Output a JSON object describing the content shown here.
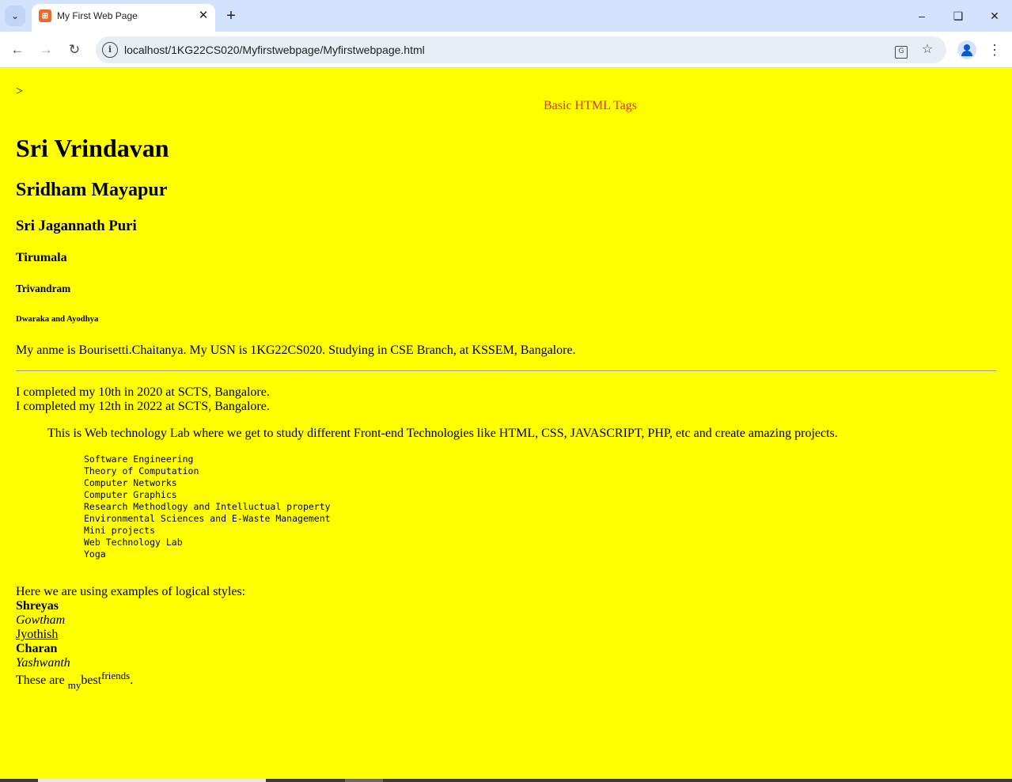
{
  "browser": {
    "tab_title": "My First Web Page",
    "url": "localhost/1KG22CS020/Myfirstwebpage/Myfirstwebpage.html"
  },
  "page": {
    "background_color": "#ffff00",
    "stray_text": ">",
    "marquee_text": "Basic HTML Tags",
    "marquee_color": "#e0301e",
    "headings": {
      "h1": "Sri Vrindavan",
      "h2": "Sridham Mayapur",
      "h3": "Sri Jagannath Puri",
      "h4": "Tirumala",
      "h5": "Trivandram",
      "h6": "Dwaraka and Ayodhya"
    },
    "intro_paragraph": "My anme is Bourisetti.Chaitanya. My USN is 1KG22CS020. Studying in CSE Branch, at KSSEM, Bangalore.",
    "education": [
      "I completed my 10th in 2020 at SCTS, Bangalore.",
      "I completed my 12th in 2022 at SCTS, Bangalore."
    ],
    "blockquote": "This is Web technology Lab where we get to study different Front-end Technologies like HTML, CSS, JAVASCRIPT, PHP, etc and create amazing projects.",
    "subjects": [
      "Software Engineering",
      "Theory of Computation",
      "Computer Networks",
      "Computer Graphics",
      "Research Methodlogy and Intelluctual property",
      "Environmental Sciences and E-Waste Management",
      "Mini projects",
      "Web Technology Lab",
      "Yoga"
    ],
    "logical_styles": {
      "intro": "Here we are using examples of logical styles:",
      "bold1": "Shreyas",
      "italic1": "Gowtham",
      "underline": "Jyothish",
      "bold2": "Charan",
      "italic2": "Yashwanth",
      "last_line": {
        "before": "These are ",
        "sub": "my",
        "middle": "best",
        "sup": "friends",
        "after": "."
      }
    }
  }
}
